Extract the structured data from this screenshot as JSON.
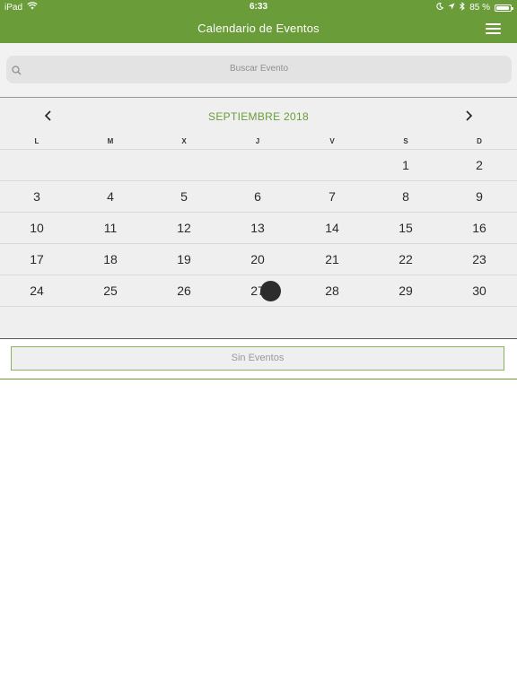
{
  "status_bar": {
    "device": "iPad",
    "time": "6:33",
    "battery": "85 %",
    "battery_level": 0.85
  },
  "navbar": {
    "title": "Calendario de Eventos",
    "menu_icon": "hamburger-menu-icon"
  },
  "search": {
    "placeholder": "Buscar Evento",
    "icon": "search-icon"
  },
  "calendar": {
    "month_label": "SEPTIEMBRE 2018",
    "prev_icon": "chevron-left-icon",
    "next_icon": "chevron-right-icon",
    "weekdays": [
      "L",
      "M",
      "X",
      "J",
      "V",
      "S",
      "D"
    ],
    "weeks": [
      [
        "",
        "",
        "",
        "",
        "",
        "1",
        "2"
      ],
      [
        "3",
        "4",
        "5",
        "6",
        "7",
        "8",
        "9"
      ],
      [
        "10",
        "11",
        "12",
        "13",
        "14",
        "15",
        "16"
      ],
      [
        "17",
        "18",
        "19",
        "20",
        "21",
        "22",
        "23"
      ],
      [
        "24",
        "25",
        "26",
        "27",
        "28",
        "29",
        "30"
      ]
    ],
    "today": "27",
    "accent_color": "#6a9d3a"
  },
  "events": {
    "empty_label": "Sin Eventos"
  }
}
